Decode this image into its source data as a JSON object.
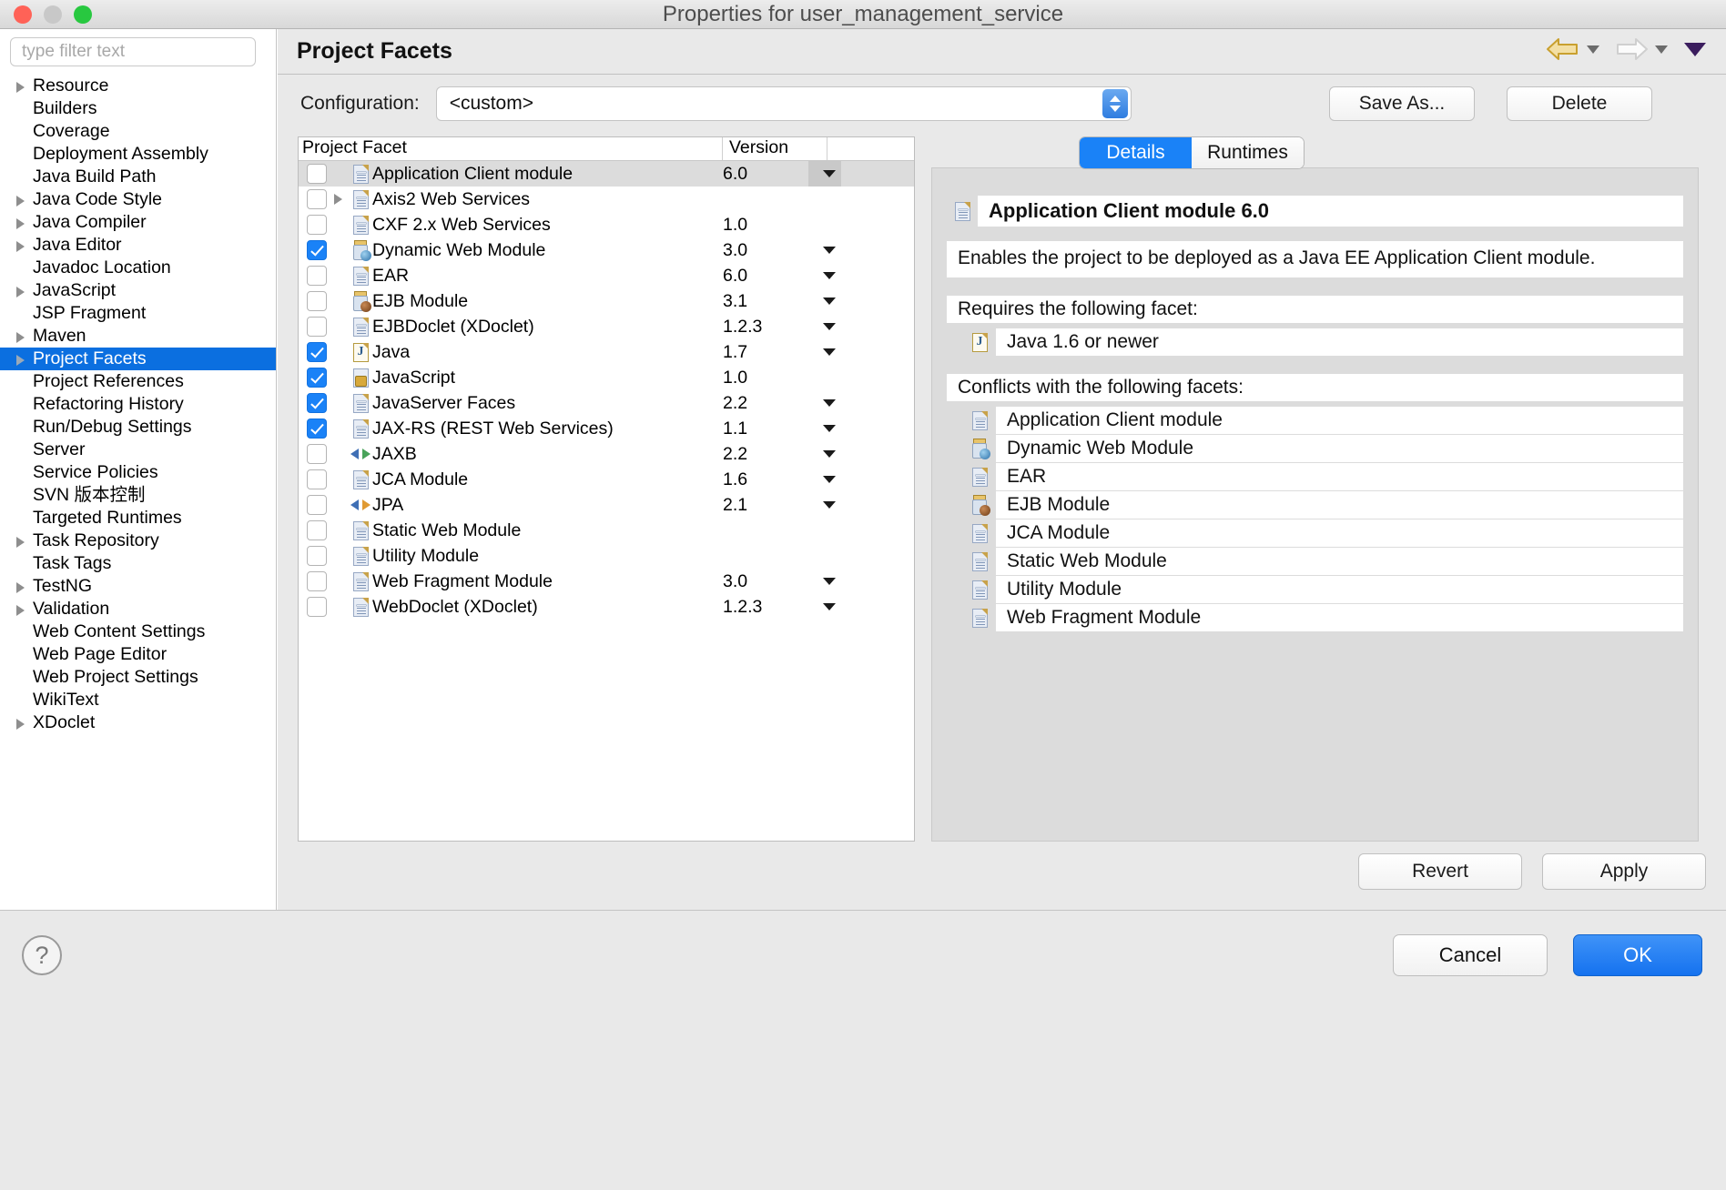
{
  "window": {
    "title": "Properties for user_management_service",
    "controls": [
      "close",
      "minimize",
      "zoom"
    ]
  },
  "sidebar": {
    "filter_placeholder": "type filter text",
    "items": [
      {
        "label": "Resource",
        "expandable": true,
        "selected": false
      },
      {
        "label": "Builders",
        "expandable": false,
        "selected": false
      },
      {
        "label": "Coverage",
        "expandable": false,
        "selected": false
      },
      {
        "label": "Deployment Assembly",
        "expandable": false,
        "selected": false
      },
      {
        "label": "Java Build Path",
        "expandable": false,
        "selected": false
      },
      {
        "label": "Java Code Style",
        "expandable": true,
        "selected": false
      },
      {
        "label": "Java Compiler",
        "expandable": true,
        "selected": false
      },
      {
        "label": "Java Editor",
        "expandable": true,
        "selected": false
      },
      {
        "label": "Javadoc Location",
        "expandable": false,
        "selected": false
      },
      {
        "label": "JavaScript",
        "expandable": true,
        "selected": false
      },
      {
        "label": "JSP Fragment",
        "expandable": false,
        "selected": false
      },
      {
        "label": "Maven",
        "expandable": true,
        "selected": false
      },
      {
        "label": "Project Facets",
        "expandable": true,
        "selected": true
      },
      {
        "label": "Project References",
        "expandable": false,
        "selected": false
      },
      {
        "label": "Refactoring History",
        "expandable": false,
        "selected": false
      },
      {
        "label": "Run/Debug Settings",
        "expandable": false,
        "selected": false
      },
      {
        "label": "Server",
        "expandable": false,
        "selected": false
      },
      {
        "label": "Service Policies",
        "expandable": false,
        "selected": false
      },
      {
        "label": "SVN 版本控制",
        "expandable": false,
        "selected": false
      },
      {
        "label": "Targeted Runtimes",
        "expandable": false,
        "selected": false
      },
      {
        "label": "Task Repository",
        "expandable": true,
        "selected": false
      },
      {
        "label": "Task Tags",
        "expandable": false,
        "selected": false
      },
      {
        "label": "TestNG",
        "expandable": true,
        "selected": false
      },
      {
        "label": "Validation",
        "expandable": true,
        "selected": false
      },
      {
        "label": "Web Content Settings",
        "expandable": false,
        "selected": false
      },
      {
        "label": "Web Page Editor",
        "expandable": false,
        "selected": false
      },
      {
        "label": "Web Project Settings",
        "expandable": false,
        "selected": false
      },
      {
        "label": "WikiText",
        "expandable": false,
        "selected": false
      },
      {
        "label": "XDoclet",
        "expandable": true,
        "selected": false
      }
    ]
  },
  "pane": {
    "title": "Project Facets",
    "nav": {
      "back_icon": "back-arrow-icon",
      "forward_icon": "forward-arrow-icon",
      "menu_icon": "dropdown-caret-icon"
    }
  },
  "configuration": {
    "label": "Configuration:",
    "value": "<custom>",
    "save_as_label": "Save As...",
    "delete_label": "Delete"
  },
  "facet_table": {
    "columns": [
      "Project Facet",
      "Version"
    ],
    "rows": [
      {
        "name": "Application Client module",
        "version": "6.0",
        "checked": false,
        "has_caret": true,
        "expandable": false,
        "icon": "doc",
        "selected": true
      },
      {
        "name": "Axis2 Web Services",
        "version": "",
        "checked": false,
        "has_caret": false,
        "expandable": true,
        "icon": "doc",
        "selected": false
      },
      {
        "name": "CXF 2.x Web Services",
        "version": "1.0",
        "checked": false,
        "has_caret": false,
        "expandable": false,
        "icon": "doc",
        "selected": false
      },
      {
        "name": "Dynamic Web Module",
        "version": "3.0",
        "checked": true,
        "has_caret": true,
        "expandable": false,
        "icon": "jar-globe",
        "selected": false
      },
      {
        "name": "EAR",
        "version": "6.0",
        "checked": false,
        "has_caret": true,
        "expandable": false,
        "icon": "doc",
        "selected": false
      },
      {
        "name": "EJB Module",
        "version": "3.1",
        "checked": false,
        "has_caret": true,
        "expandable": false,
        "icon": "jar-bean",
        "selected": false
      },
      {
        "name": "EJBDoclet (XDoclet)",
        "version": "1.2.3",
        "checked": false,
        "has_caret": true,
        "expandable": false,
        "icon": "doc",
        "selected": false
      },
      {
        "name": "Java",
        "version": "1.7",
        "checked": true,
        "has_caret": true,
        "expandable": false,
        "icon": "java",
        "selected": false
      },
      {
        "name": "JavaScript",
        "version": "1.0",
        "checked": true,
        "has_caret": false,
        "expandable": false,
        "icon": "js-lock",
        "selected": false
      },
      {
        "name": "JavaServer Faces",
        "version": "2.2",
        "checked": true,
        "has_caret": true,
        "expandable": false,
        "icon": "doc",
        "selected": false
      },
      {
        "name": "JAX-RS (REST Web Services)",
        "version": "1.1",
        "checked": true,
        "has_caret": true,
        "expandable": false,
        "icon": "doc",
        "selected": false
      },
      {
        "name": "JAXB",
        "version": "2.2",
        "checked": false,
        "has_caret": true,
        "expandable": false,
        "icon": "arrows-green",
        "selected": false
      },
      {
        "name": "JCA Module",
        "version": "1.6",
        "checked": false,
        "has_caret": true,
        "expandable": false,
        "icon": "doc",
        "selected": false
      },
      {
        "name": "JPA",
        "version": "2.1",
        "checked": false,
        "has_caret": true,
        "expandable": false,
        "icon": "arrows-orange",
        "selected": false
      },
      {
        "name": "Static Web Module",
        "version": "",
        "checked": false,
        "has_caret": false,
        "expandable": false,
        "icon": "doc",
        "selected": false
      },
      {
        "name": "Utility Module",
        "version": "",
        "checked": false,
        "has_caret": false,
        "expandable": false,
        "icon": "doc",
        "selected": false
      },
      {
        "name": "Web Fragment Module",
        "version": "3.0",
        "checked": false,
        "has_caret": true,
        "expandable": false,
        "icon": "doc",
        "selected": false
      },
      {
        "name": "WebDoclet (XDoclet)",
        "version": "1.2.3",
        "checked": false,
        "has_caret": true,
        "expandable": false,
        "icon": "doc",
        "selected": false
      }
    ]
  },
  "details": {
    "tabs": [
      {
        "label": "Details",
        "active": true
      },
      {
        "label": "Runtimes",
        "active": false
      }
    ],
    "facet_title": "Application Client module 6.0",
    "description": "Enables the project to be deployed as a Java EE Application Client module.",
    "requires_heading": "Requires the following facet:",
    "requires": [
      {
        "label": "Java 1.6 or newer",
        "icon": "java"
      }
    ],
    "conflicts_heading": "Conflicts with the following facets:",
    "conflicts": [
      {
        "label": "Application Client module",
        "icon": "doc"
      },
      {
        "label": "Dynamic Web Module",
        "icon": "jar-globe"
      },
      {
        "label": "EAR",
        "icon": "doc"
      },
      {
        "label": "EJB Module",
        "icon": "jar-bean"
      },
      {
        "label": "JCA Module",
        "icon": "doc"
      },
      {
        "label": "Static Web Module",
        "icon": "doc"
      },
      {
        "label": "Utility Module",
        "icon": "doc"
      },
      {
        "label": "Web Fragment Module",
        "icon": "doc"
      }
    ]
  },
  "actions": {
    "revert_label": "Revert",
    "apply_label": "Apply"
  },
  "footer": {
    "help_label": "?",
    "cancel_label": "Cancel",
    "ok_label": "OK"
  },
  "colors": {
    "accent_blue": "#1a82f7",
    "selection_blue": "#0b6fe0",
    "row_selected_gray": "#dcdcdc",
    "window_bg": "#e9e9e9"
  }
}
